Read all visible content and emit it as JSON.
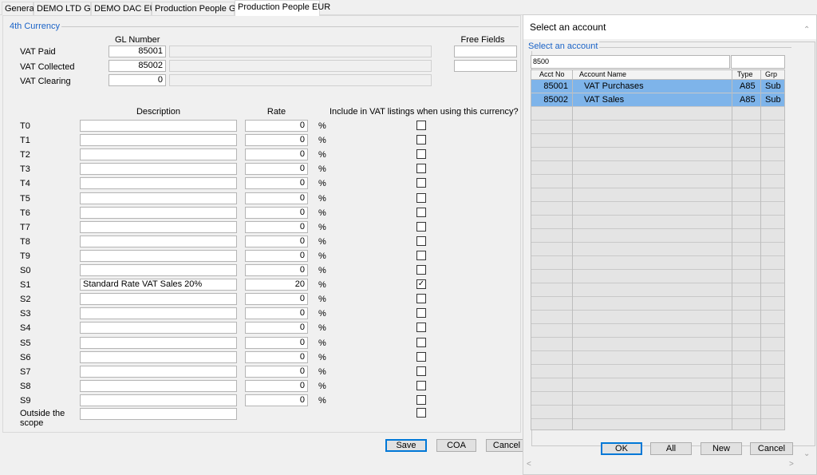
{
  "tabs": [
    "General",
    "DEMO LTD GBP",
    "DEMO DAC EUR",
    "Production People GBP",
    "Production People EUR"
  ],
  "group_title": "4th Currency",
  "gl": {
    "header": "GL Number",
    "rows": [
      {
        "label": "VAT Paid",
        "value": "85001"
      },
      {
        "label": "VAT Collected",
        "value": "85002"
      },
      {
        "label": "VAT Clearing",
        "value": "0"
      }
    ]
  },
  "free_fields_header": "Free Fields",
  "table": {
    "desc_header": "Description",
    "rate_header": "Rate",
    "include_header": "Include in VAT listings when using this currency?",
    "percent": "%",
    "rows": [
      {
        "code": "T0",
        "desc": "",
        "rate": "0",
        "checked": false
      },
      {
        "code": "T1",
        "desc": "",
        "rate": "0",
        "checked": false
      },
      {
        "code": "T2",
        "desc": "",
        "rate": "0",
        "checked": false
      },
      {
        "code": "T3",
        "desc": "",
        "rate": "0",
        "checked": false
      },
      {
        "code": "T4",
        "desc": "",
        "rate": "0",
        "checked": false
      },
      {
        "code": "T5",
        "desc": "",
        "rate": "0",
        "checked": false
      },
      {
        "code": "T6",
        "desc": "",
        "rate": "0",
        "checked": false
      },
      {
        "code": "T7",
        "desc": "",
        "rate": "0",
        "checked": false
      },
      {
        "code": "T8",
        "desc": "",
        "rate": "0",
        "checked": false
      },
      {
        "code": "T9",
        "desc": "",
        "rate": "0",
        "checked": false
      },
      {
        "code": "S0",
        "desc": "",
        "rate": "0",
        "checked": false
      },
      {
        "code": "S1",
        "desc": "Standard Rate VAT Sales 20%",
        "rate": "20",
        "checked": true
      },
      {
        "code": "S2",
        "desc": "",
        "rate": "0",
        "checked": false
      },
      {
        "code": "S3",
        "desc": "",
        "rate": "0",
        "checked": false
      },
      {
        "code": "S4",
        "desc": "",
        "rate": "0",
        "checked": false
      },
      {
        "code": "S5",
        "desc": "",
        "rate": "0",
        "checked": false
      },
      {
        "code": "S6",
        "desc": "",
        "rate": "0",
        "checked": false
      },
      {
        "code": "S7",
        "desc": "",
        "rate": "0",
        "checked": false
      },
      {
        "code": "S8",
        "desc": "",
        "rate": "0",
        "checked": false
      },
      {
        "code": "S9",
        "desc": "",
        "rate": "0",
        "checked": false
      }
    ],
    "outside_label_1": "Outside the",
    "outside_label_2": "scope"
  },
  "buttons": {
    "save": "Save",
    "coa": "COA",
    "cancel": "Cancel"
  },
  "dialog": {
    "title": "Select an account",
    "group_title": "Select an account",
    "search_value": "8500",
    "columns": [
      "Acct No",
      "Account Name",
      "Type",
      "Grp"
    ],
    "rows": [
      {
        "acct": "85001",
        "name": "VAT Purchases",
        "type": "A85",
        "grp": "Sub"
      },
      {
        "acct": "85002",
        "name": "VAT Sales",
        "type": "A85",
        "grp": "Sub"
      }
    ],
    "buttons": {
      "ok": "OK",
      "all": "All",
      "new": "New",
      "cancel": "Cancel"
    }
  },
  "check_glyph": "✓",
  "colors": {
    "selection": "#7eb4ea",
    "legend": "#1a63c7",
    "default_button": "#0078d7"
  }
}
